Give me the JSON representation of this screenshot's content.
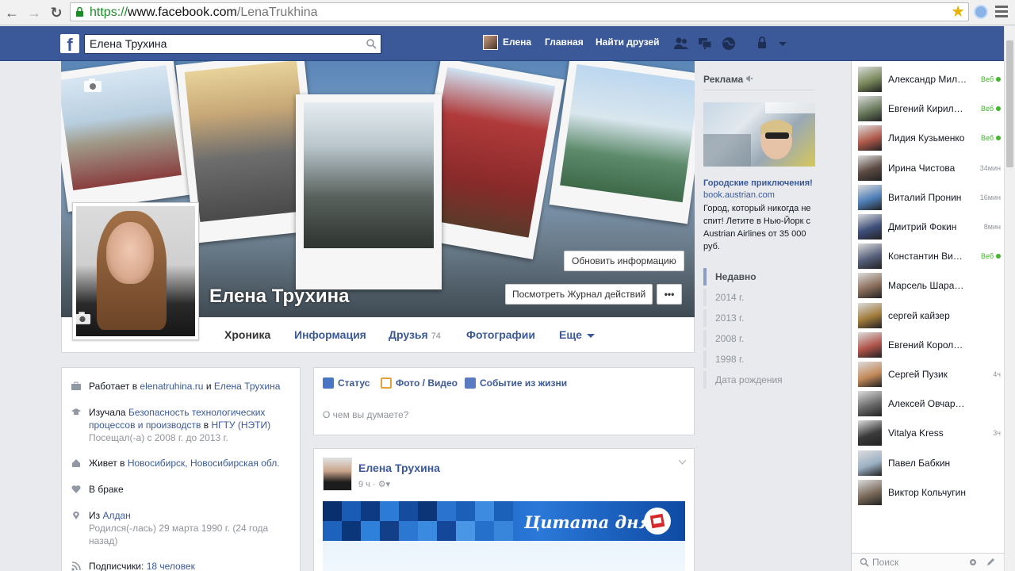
{
  "browser": {
    "url_protocol": "https://",
    "url_host": "www.facebook.com",
    "url_path": "/LenaTrukhina"
  },
  "topbar": {
    "search_value": "Елена Трухина",
    "user_name": "Елена",
    "home_label": "Главная",
    "find_friends_label": "Найти друзей"
  },
  "profile": {
    "name": "Елена Трухина",
    "update_info_label": "Обновить информацию",
    "activity_log_label": "Посмотреть Журнал действий",
    "more_label": "•••"
  },
  "tabs": [
    {
      "label": "Хроника",
      "count": ""
    },
    {
      "label": "Информация",
      "count": ""
    },
    {
      "label": "Друзья",
      "count": "74"
    },
    {
      "label": "Фотографии",
      "count": ""
    },
    {
      "label": "Еще",
      "count": ""
    }
  ],
  "about": {
    "work_prefix": "Работает в ",
    "work_link": "elenatruhina.ru",
    "work_mid": " и ",
    "work_link2": "Елена Трухина",
    "edu_prefix": "Изучала ",
    "edu_link": "Безопасность технологических процессов и производств",
    "edu_mid": " в ",
    "edu_link2": "НГТУ (НЭТИ)",
    "edu_sub": "Посещал(-а) с 2008 г. до 2013 г.",
    "lives_prefix": "Живет в ",
    "lives_link": "Новосибирск, Новосибирская обл.",
    "relationship": "В браке",
    "from_prefix": "Из ",
    "from_link": "Алдан",
    "born": "Родился(-лась) 29 марта 1990 г. (24 года назад)",
    "followers_prefix": "Подписчики: ",
    "followers_link": "18 человек"
  },
  "composer": {
    "status_label": "Статус",
    "photo_label": "Фото / Видео",
    "event_label": "Событие из жизни",
    "placeholder": "О чем вы думаете?"
  },
  "post": {
    "author": "Елена Трухина",
    "time": "9 ч",
    "banner_text": "Цитата дня"
  },
  "ads": {
    "title": "Реклама",
    "headline": "Городские приключения!",
    "domain": "book.austrian.com",
    "text": "Город, который никогда не спит! Летите в Нью-Йорк с Austrian Airlines от 35 000 руб."
  },
  "timeline_years": [
    "Недавно",
    "2014 г.",
    "2013 г.",
    "2008 г.",
    "1998 г.",
    "Дата рождения"
  ],
  "chat": {
    "search_placeholder": "Поиск",
    "friends": [
      {
        "name": "Александр Миллер",
        "status": "Веб",
        "online": true,
        "color": "#7a8a5c"
      },
      {
        "name": "Евгений Кириллов",
        "status": "Веб",
        "online": true,
        "color": "#6b7c5e"
      },
      {
        "name": "Лидия Кузьменко",
        "status": "Веб",
        "online": true,
        "color": "#b05a4a"
      },
      {
        "name": "Ирина Чистова",
        "status": "34мин",
        "online": false,
        "color": "#5b4a42"
      },
      {
        "name": "Виталий Пронин",
        "status": "16мин",
        "online": false,
        "color": "#4e7fb8"
      },
      {
        "name": "Дмитрий Фокин",
        "status": "8мин",
        "online": false,
        "color": "#3e4f7a"
      },
      {
        "name": "Константин Вишн...",
        "status": "Веб",
        "online": true,
        "color": "#56607a"
      },
      {
        "name": "Марсель Шарафиев",
        "status": "",
        "online": false,
        "color": "#8a6d5a"
      },
      {
        "name": "сергей кайзер",
        "status": "",
        "online": false,
        "color": "#a07a3a"
      },
      {
        "name": "Евгений Корольков",
        "status": "",
        "online": false,
        "color": "#b0554a"
      },
      {
        "name": "Сергей Пузик",
        "status": "4ч",
        "online": false,
        "color": "#c48a5a"
      },
      {
        "name": "Алексей Овчаренко",
        "status": "",
        "online": false,
        "color": "#6a6a6a"
      },
      {
        "name": "Vitalya Kress",
        "status": "3ч",
        "online": false,
        "color": "#3a3a3a"
      },
      {
        "name": "Павел Бабкин",
        "status": "",
        "online": false,
        "color": "#9cb0c4"
      },
      {
        "name": "Виктор Кольчугин",
        "status": "",
        "online": false,
        "color": "#7a6a5a"
      }
    ]
  }
}
